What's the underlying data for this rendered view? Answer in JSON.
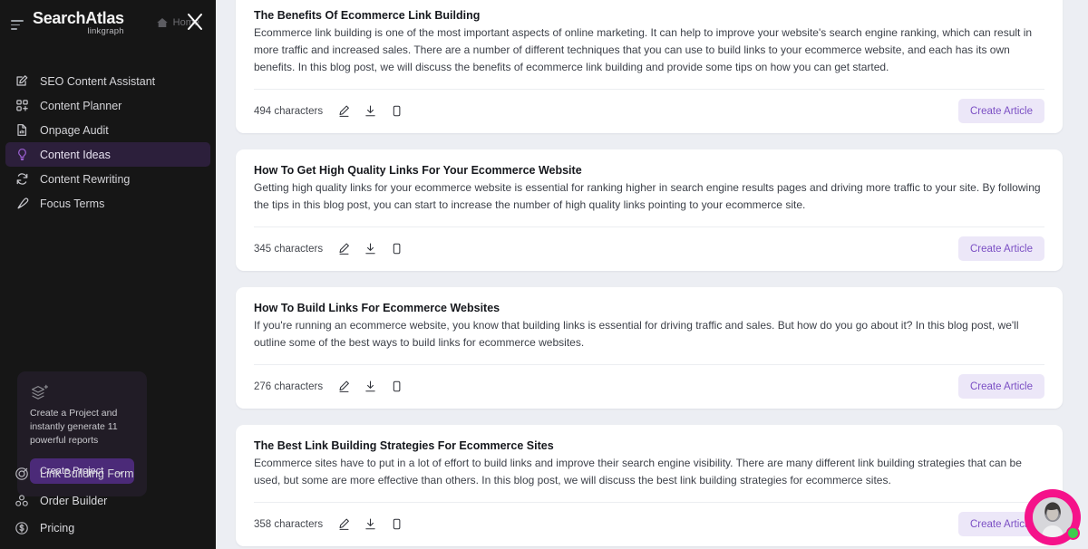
{
  "sidebar": {
    "brand": {
      "name": "SearchAtlas",
      "sub": "linkgraph",
      "menu_icon": "hamburger-icon"
    },
    "home_label": "Home",
    "close_label": "",
    "nav_items": [
      {
        "label": "SEO Content Assistant",
        "icon": "pencil-square-icon",
        "active": false
      },
      {
        "label": "Content Planner",
        "icon": "grid-plus-icon",
        "active": false
      },
      {
        "label": "Onpage Audit",
        "icon": "document-chart-icon",
        "active": false
      },
      {
        "label": "Content Ideas",
        "icon": "lightbulb-icon",
        "active": true
      },
      {
        "label": "Content Rewriting",
        "icon": "refresh-icon",
        "active": false
      },
      {
        "label": "Focus Terms",
        "icon": "pen-icon",
        "active": false
      }
    ],
    "promo": {
      "icon": "layers-plus-icon",
      "text": "Create a Project and instantly generate 11 powerful reports",
      "button_label": "Create Project",
      "button_arrow": "→"
    },
    "bottom_items": [
      {
        "label": "Link Building Form",
        "icon": "link-target-icon"
      },
      {
        "label": "Order Builder",
        "icon": "blocks-icon"
      },
      {
        "label": "Pricing",
        "icon": "dollar-circle-icon"
      }
    ]
  },
  "main": {
    "action_icons": [
      "edit-pencil-icon",
      "download-icon",
      "copy-icon"
    ],
    "create_label": "Create Article",
    "cards": [
      {
        "title": "The Benefits Of Ecommerce Link Building",
        "description": "Ecommerce link building is one of the most important aspects of online marketing. It can help to improve your website's search engine ranking, which can result in more traffic and increased sales. There are a number of different techniques that you can use to build links to your ecommerce website, and each has its own benefits. In this blog post, we will discuss the benefits of ecommerce link building and provide some tips on how you can get started.",
        "characters": "494 characters"
      },
      {
        "title": "How To Get High Quality Links For Your Ecommerce Website",
        "description": "Getting high quality links for your ecommerce website is essential for ranking higher in search engine results pages and driving more traffic to your site. By following the tips in this blog post, you can start to increase the number of high quality links pointing to your ecommerce site.",
        "characters": "345 characters"
      },
      {
        "title": "How To Build Links For Ecommerce Websites",
        "description": "If you're running an ecommerce website, you know that building links is essential for driving traffic and sales. But how do you go about it? In this blog post, we'll outline some of the best ways to build links for ecommerce websites.",
        "characters": "276 characters"
      },
      {
        "title": "The Best Link Building Strategies For Ecommerce Sites",
        "description": "Ecommerce sites have to put in a lot of effort to build links and improve their search engine visibility. There are many different link building strategies that can be used, but some are more effective than others. In this blog post, we will discuss the best link building strategies for ecommerce sites.",
        "characters": "358 characters"
      }
    ]
  },
  "chat": {
    "icon": "support-agent-avatar",
    "status": "online"
  },
  "colors": {
    "sidebar_bg": "#161616",
    "active_nav_bg": "#2c1f3b",
    "accent_purple": "#7b4fc4",
    "promo_button": "#4b2a78",
    "page_bg": "#eceef3",
    "chat_pink": "#f5128a",
    "status_green": "#3fcc4e"
  }
}
